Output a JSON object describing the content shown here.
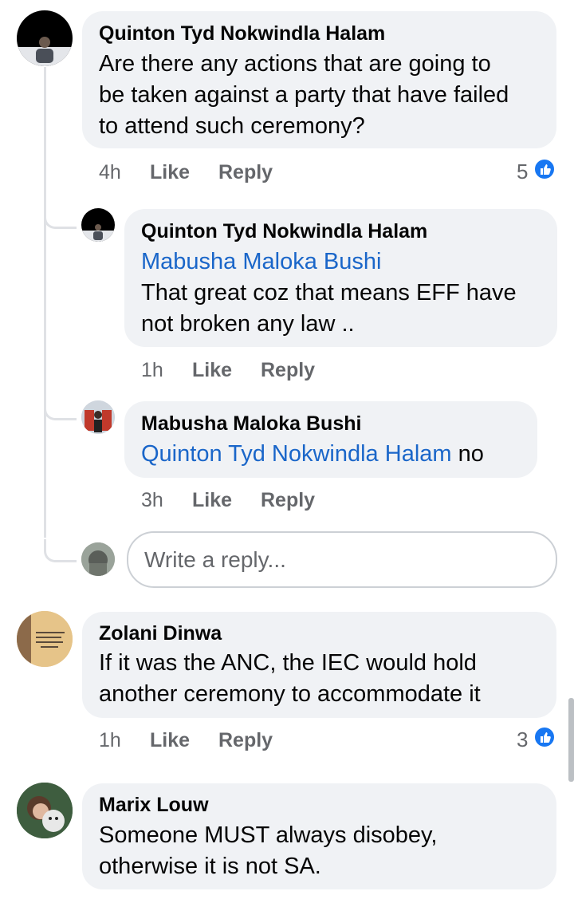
{
  "comments": [
    {
      "author": "Quinton Tyd Nokwindla Halam",
      "lines": [
        "Are there any actions that are going to",
        "be taken against a party that have failed",
        "to attend such ceremony?"
      ],
      "time": "4h",
      "like": "Like",
      "reply": "Reply",
      "reactions": "5"
    },
    {
      "author": "Quinton Tyd Nokwindla Halam",
      "mention": "Mabusha Maloka Bushi",
      "lines": [
        "That great coz that means EFF have",
        "not broken any law .."
      ],
      "time": "1h",
      "like": "Like",
      "reply": "Reply"
    },
    {
      "author": "Mabusha Maloka Bushi",
      "mention": "Quinton Tyd Nokwindla Halam",
      "text_after_mention": " no",
      "time": "3h",
      "like": "Like",
      "reply": "Reply"
    },
    {
      "author": "Zolani Dinwa",
      "lines": [
        "If it was the ANC, the IEC would hold",
        "another ceremony to accommodate it"
      ],
      "time": "1h",
      "like": "Like",
      "reply": "Reply",
      "reactions": "3"
    },
    {
      "author": "Marix Louw",
      "lines": [
        "Someone MUST always disobey,",
        "otherwise it is not SA."
      ]
    }
  ],
  "reply_box": {
    "placeholder": "Write a reply..."
  },
  "colors": {
    "bubble": "#f0f2f5",
    "mention": "#1a66c9",
    "like_blue": "#1877f2",
    "meta": "#65676b"
  },
  "icons": [
    "like-icon"
  ]
}
